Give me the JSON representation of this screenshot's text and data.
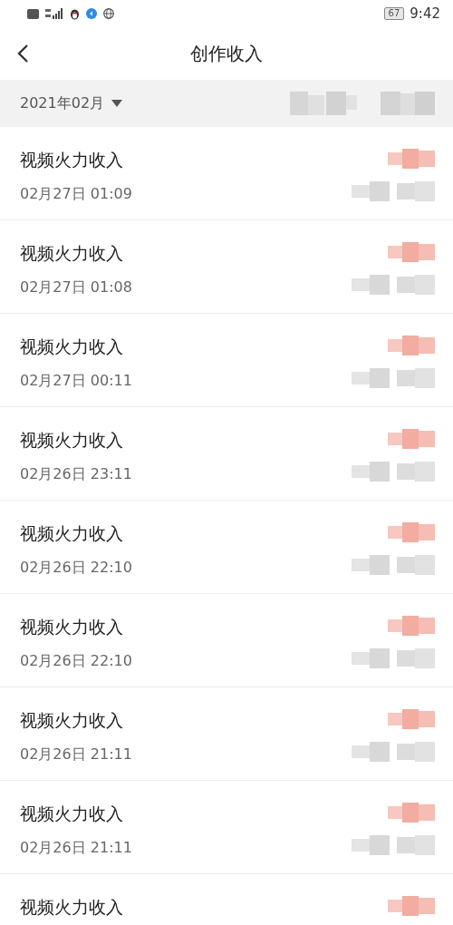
{
  "status_bar": {
    "battery": "67",
    "time": "9:42"
  },
  "nav": {
    "title": "创作收入"
  },
  "filter": {
    "month": "2021年02月"
  },
  "records": [
    {
      "title": "视频火力收入",
      "time": "02月27日 01:09"
    },
    {
      "title": "视频火力收入",
      "time": "02月27日 01:08"
    },
    {
      "title": "视频火力收入",
      "time": "02月27日 00:11"
    },
    {
      "title": "视频火力收入",
      "time": "02月26日 23:11"
    },
    {
      "title": "视频火力收入",
      "time": "02月26日 22:10"
    },
    {
      "title": "视频火力收入",
      "time": "02月26日 22:10"
    },
    {
      "title": "视频火力收入",
      "time": "02月26日 21:11"
    },
    {
      "title": "视频火力收入",
      "time": "02月26日 21:11"
    },
    {
      "title": "视频火力收入"
    }
  ]
}
